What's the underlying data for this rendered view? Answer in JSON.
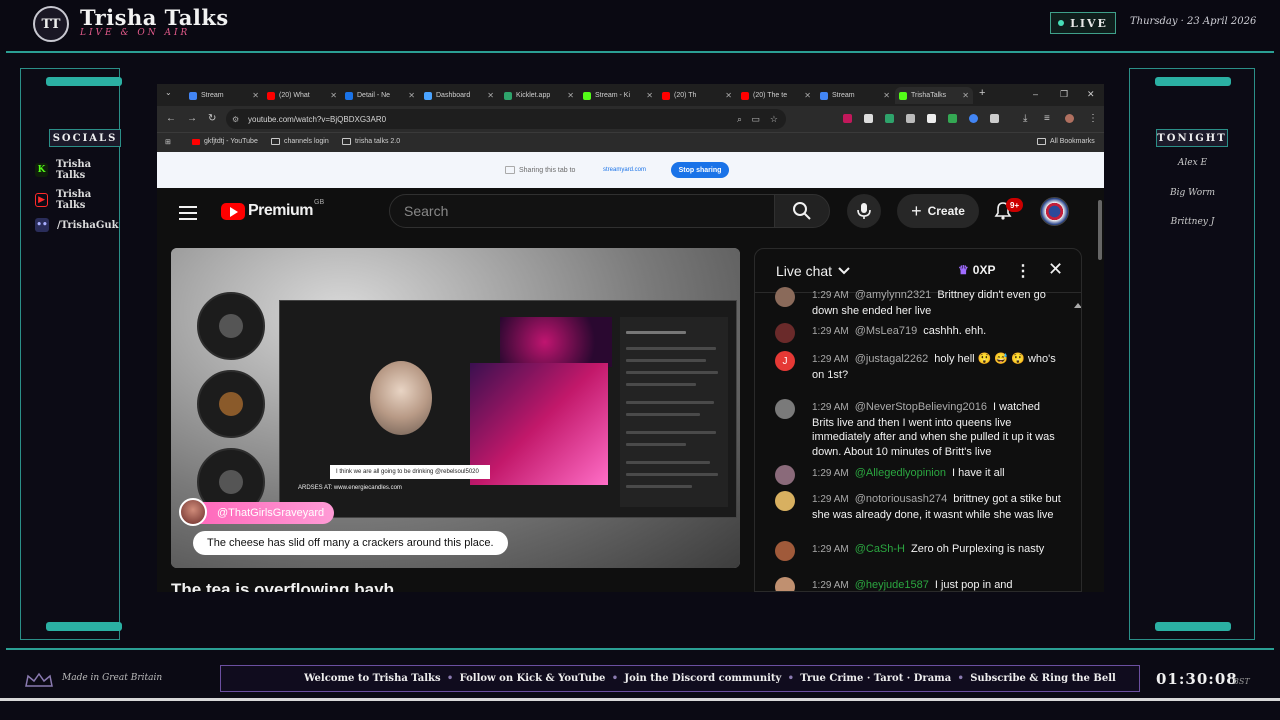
{
  "overlay": {
    "logo_text": "TT",
    "brand_name": "Trisha Talks",
    "brand_tagline": "LIVE & ON AIR",
    "live_label": "LIVE",
    "date": "Thursday · 23 April 2026",
    "socials_heading": "SOCIALS",
    "socials": [
      {
        "icon": "kick-icon",
        "label": "Trisha Talks",
        "color": "#53fc18"
      },
      {
        "icon": "youtube-icon",
        "label": "Trisha Talks",
        "color": "#ff0000"
      },
      {
        "icon": "discord-icon",
        "label": "/TrishaGuk",
        "color": "#5865f2"
      }
    ],
    "tonight_heading": "TONIGHT",
    "tonight": [
      "Alex E",
      "Big Worm",
      "Brittney J"
    ],
    "made_in": "Made in Great Britain",
    "ticker": [
      "Welcome to Trisha Talks",
      "Follow on Kick & YouTube",
      "Join the Discord community",
      "True Crime · Tarot · Drama",
      "Subscribe & Ring the Bell"
    ],
    "clock": "01:30:08",
    "clock_tz": "BST"
  },
  "browser": {
    "tabs": [
      {
        "label": "Stream",
        "fav": "#4285f4"
      },
      {
        "label": "(20) What",
        "fav": "#ff0000"
      },
      {
        "label": "Detail - Ne",
        "fav": "#1a73e8"
      },
      {
        "label": "Dashboard",
        "fav": "#4aa3ff"
      },
      {
        "label": "Kicklet.app",
        "fav": "#2ea36b"
      },
      {
        "label": "Stream - Ki",
        "fav": "#53fc18"
      },
      {
        "label": "(20) Th",
        "fav": "#ff0000"
      },
      {
        "label": "(20) The te",
        "fav": "#ff0000"
      },
      {
        "label": "Stream",
        "fav": "#4285f4"
      },
      {
        "label": "TrishaTalks",
        "fav": "#53fc18"
      }
    ],
    "url": "youtube.com/watch?v=BjQBDXG3AR0",
    "bookmarks": [
      "gkfjtdtj - YouTube",
      "channels login",
      "trisha talks 2.0"
    ],
    "all_bookmarks": "All Bookmarks",
    "share_text": "Sharing this tab to",
    "share_target": "streamyard.com",
    "stop_sharing": "Stop sharing"
  },
  "youtube": {
    "logo_text": "Premium",
    "region": "GB",
    "search_placeholder": "Search",
    "create_label": "Create",
    "notif_count": "9+",
    "video_title": "The tea is overflowing bayb",
    "overlay_username": "@ThatGirlsGraveyard",
    "overlay_message": "The cheese has slid off many a crackers around this place.",
    "nested_message": "I think we are all going to be drinking @rebelsoul5020",
    "nested_url": "ARDSES AT: www.energiecandles.com"
  },
  "chat": {
    "title": "Live chat",
    "xp": "0XP",
    "messages": [
      {
        "time": "1:29 AM",
        "author": "@amylynn2321",
        "text": "Brittney didn't even go down she ended her live",
        "avatar": "#8a6a5a",
        "green": false
      },
      {
        "time": "1:29 AM",
        "author": "@MsLea719",
        "text": "cashhh. ehh.",
        "avatar": "#6a2a2a",
        "green": false
      },
      {
        "time": "1:29 AM",
        "author": "@justagal2262",
        "text": "holy hell 😲 😅 😲 who's on 1st?",
        "avatar": "#e53935",
        "green": false
      },
      {
        "time": "1:29 AM",
        "author": "@NeverStopBelieving2016",
        "text": "I watched Brits live and then I went into queens live immediately after and when she pulled it up it was down. About 10 minutes of Britt's live",
        "avatar": "#7a7a7a",
        "green": false
      },
      {
        "time": "1:29 AM",
        "author": "@Allegedlyopinion",
        "text": "I have it all",
        "avatar": "#8a6a7a",
        "green": true
      },
      {
        "time": "1:29 AM",
        "author": "@notoriousash274",
        "text": "brittney got a stike but she was already done, it wasnt while she was live",
        "avatar": "#d8b060",
        "green": false
      },
      {
        "time": "1:29 AM",
        "author": "@CaSh-H",
        "text": "Zero oh Purplexing is nasty",
        "avatar": "#a05a3a",
        "green": true
      },
      {
        "time": "1:29 AM",
        "author": "@heyjude1587",
        "text": "I just pop in and",
        "avatar": "#c09070",
        "green": true
      }
    ]
  }
}
